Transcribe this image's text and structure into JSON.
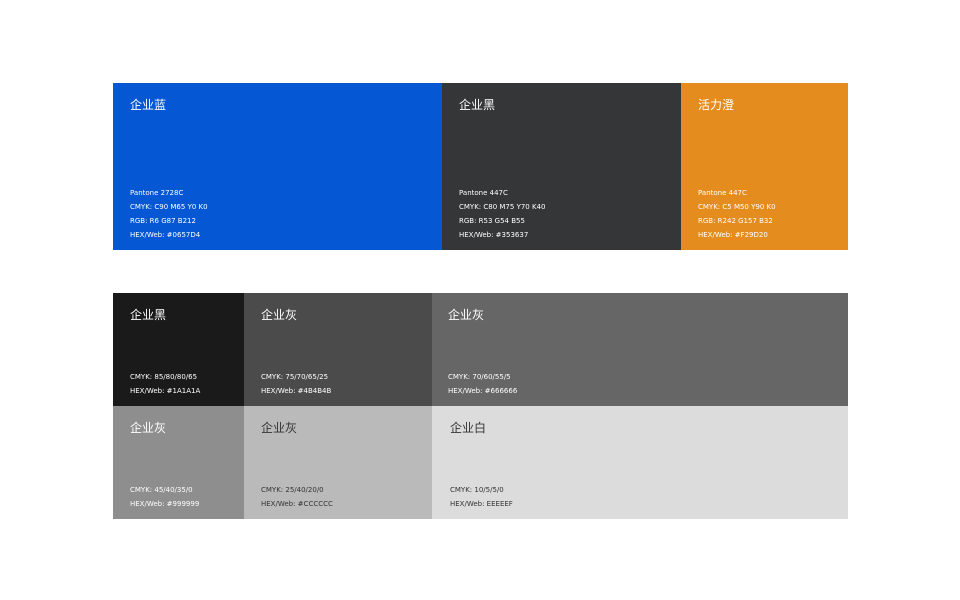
{
  "palette_top": [
    {
      "name": "企业蓝",
      "bg": "#0657D4",
      "fg": "#FFFFFF",
      "specs": [
        "Pantone 2728C",
        "CMYK: C90 M65 Y0 K0",
        "RGB: R6 G87 B212",
        "HEX/Web: #0657D4"
      ]
    },
    {
      "name": "企业黑",
      "bg": "#353637",
      "fg": "#FFFFFF",
      "specs": [
        "Pantone 447C",
        "CMYK: C80 M75 Y70 K40",
        "RGB: R53 G54 B55",
        "HEX/Web: #353637"
      ]
    },
    {
      "name": "活力澄",
      "bg": "#E58C1F",
      "fg": "#FFFFFF",
      "specs": [
        "Pantone 447C",
        "CMYK: C5 M50 Y90 K0",
        "RGB: R242 G157 B32",
        "HEX/Web: #F29D20"
      ]
    }
  ],
  "palette_neutral": [
    {
      "name": "企业黑",
      "bg": "#1A1A1A",
      "fg": "#FFFFFF",
      "specs": [
        "CMYK: 85/80/80/65",
        "HEX/Web: #1A1A1A"
      ]
    },
    {
      "name": "企业灰",
      "bg": "#4B4B4B",
      "fg": "#FFFFFF",
      "specs": [
        "CMYK: 75/70/65/25",
        "HEX/Web: #4B4B4B"
      ]
    },
    {
      "name": "企业灰",
      "bg": "#666666",
      "fg": "#FFFFFF",
      "specs": [
        "CMYK: 70/60/55/5",
        "HEX/Web: #666666"
      ]
    },
    {
      "name": "企业灰",
      "bg": "#8E8E8E",
      "fg": "#FFFFFF",
      "specs": [
        "CMYK: 45/40/35/0",
        "HEX/Web: #999999"
      ]
    },
    {
      "name": "企业灰",
      "bg": "#BABABA",
      "fg": "#333333",
      "specs": [
        "CMYK: 25/40/20/0",
        "HEX/Web: #CCCCCC"
      ]
    },
    {
      "name": "企业白",
      "bg": "#DCDCDD",
      "fg": "#333333",
      "specs": [
        "CMYK: 10/5/5/0",
        "HEX/Web: EEEEEF"
      ]
    }
  ]
}
